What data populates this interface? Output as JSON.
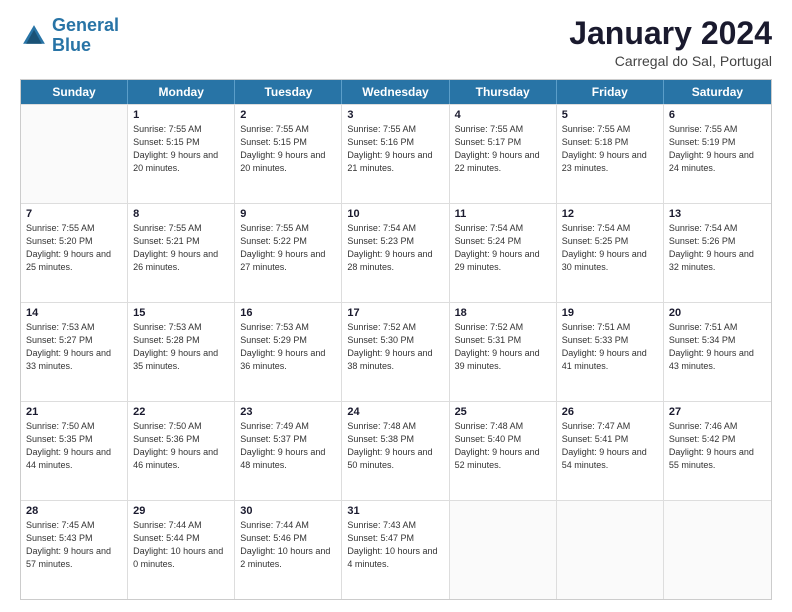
{
  "logo": {
    "line1": "General",
    "line2": "Blue"
  },
  "header": {
    "title": "January 2024",
    "subtitle": "Carregal do Sal, Portugal"
  },
  "weekdays": [
    "Sunday",
    "Monday",
    "Tuesday",
    "Wednesday",
    "Thursday",
    "Friday",
    "Saturday"
  ],
  "weeks": [
    [
      {
        "day": "",
        "empty": true
      },
      {
        "day": "1",
        "rise": "7:55 AM",
        "set": "5:15 PM",
        "daylight": "9 hours and 20 minutes."
      },
      {
        "day": "2",
        "rise": "7:55 AM",
        "set": "5:15 PM",
        "daylight": "9 hours and 20 minutes."
      },
      {
        "day": "3",
        "rise": "7:55 AM",
        "set": "5:16 PM",
        "daylight": "9 hours and 21 minutes."
      },
      {
        "day": "4",
        "rise": "7:55 AM",
        "set": "5:17 PM",
        "daylight": "9 hours and 22 minutes."
      },
      {
        "day": "5",
        "rise": "7:55 AM",
        "set": "5:18 PM",
        "daylight": "9 hours and 23 minutes."
      },
      {
        "day": "6",
        "rise": "7:55 AM",
        "set": "5:19 PM",
        "daylight": "9 hours and 24 minutes."
      }
    ],
    [
      {
        "day": "7",
        "rise": "7:55 AM",
        "set": "5:20 PM",
        "daylight": "9 hours and 25 minutes."
      },
      {
        "day": "8",
        "rise": "7:55 AM",
        "set": "5:21 PM",
        "daylight": "9 hours and 26 minutes."
      },
      {
        "day": "9",
        "rise": "7:55 AM",
        "set": "5:22 PM",
        "daylight": "9 hours and 27 minutes."
      },
      {
        "day": "10",
        "rise": "7:54 AM",
        "set": "5:23 PM",
        "daylight": "9 hours and 28 minutes."
      },
      {
        "day": "11",
        "rise": "7:54 AM",
        "set": "5:24 PM",
        "daylight": "9 hours and 29 minutes."
      },
      {
        "day": "12",
        "rise": "7:54 AM",
        "set": "5:25 PM",
        "daylight": "9 hours and 30 minutes."
      },
      {
        "day": "13",
        "rise": "7:54 AM",
        "set": "5:26 PM",
        "daylight": "9 hours and 32 minutes."
      }
    ],
    [
      {
        "day": "14",
        "rise": "7:53 AM",
        "set": "5:27 PM",
        "daylight": "9 hours and 33 minutes."
      },
      {
        "day": "15",
        "rise": "7:53 AM",
        "set": "5:28 PM",
        "daylight": "9 hours and 35 minutes."
      },
      {
        "day": "16",
        "rise": "7:53 AM",
        "set": "5:29 PM",
        "daylight": "9 hours and 36 minutes."
      },
      {
        "day": "17",
        "rise": "7:52 AM",
        "set": "5:30 PM",
        "daylight": "9 hours and 38 minutes."
      },
      {
        "day": "18",
        "rise": "7:52 AM",
        "set": "5:31 PM",
        "daylight": "9 hours and 39 minutes."
      },
      {
        "day": "19",
        "rise": "7:51 AM",
        "set": "5:33 PM",
        "daylight": "9 hours and 41 minutes."
      },
      {
        "day": "20",
        "rise": "7:51 AM",
        "set": "5:34 PM",
        "daylight": "9 hours and 43 minutes."
      }
    ],
    [
      {
        "day": "21",
        "rise": "7:50 AM",
        "set": "5:35 PM",
        "daylight": "9 hours and 44 minutes."
      },
      {
        "day": "22",
        "rise": "7:50 AM",
        "set": "5:36 PM",
        "daylight": "9 hours and 46 minutes."
      },
      {
        "day": "23",
        "rise": "7:49 AM",
        "set": "5:37 PM",
        "daylight": "9 hours and 48 minutes."
      },
      {
        "day": "24",
        "rise": "7:48 AM",
        "set": "5:38 PM",
        "daylight": "9 hours and 50 minutes."
      },
      {
        "day": "25",
        "rise": "7:48 AM",
        "set": "5:40 PM",
        "daylight": "9 hours and 52 minutes."
      },
      {
        "day": "26",
        "rise": "7:47 AM",
        "set": "5:41 PM",
        "daylight": "9 hours and 54 minutes."
      },
      {
        "day": "27",
        "rise": "7:46 AM",
        "set": "5:42 PM",
        "daylight": "9 hours and 55 minutes."
      }
    ],
    [
      {
        "day": "28",
        "rise": "7:45 AM",
        "set": "5:43 PM",
        "daylight": "9 hours and 57 minutes."
      },
      {
        "day": "29",
        "rise": "7:44 AM",
        "set": "5:44 PM",
        "daylight": "10 hours and 0 minutes."
      },
      {
        "day": "30",
        "rise": "7:44 AM",
        "set": "5:46 PM",
        "daylight": "10 hours and 2 minutes."
      },
      {
        "day": "31",
        "rise": "7:43 AM",
        "set": "5:47 PM",
        "daylight": "10 hours and 4 minutes."
      },
      {
        "day": "",
        "empty": true
      },
      {
        "day": "",
        "empty": true
      },
      {
        "day": "",
        "empty": true
      }
    ]
  ]
}
